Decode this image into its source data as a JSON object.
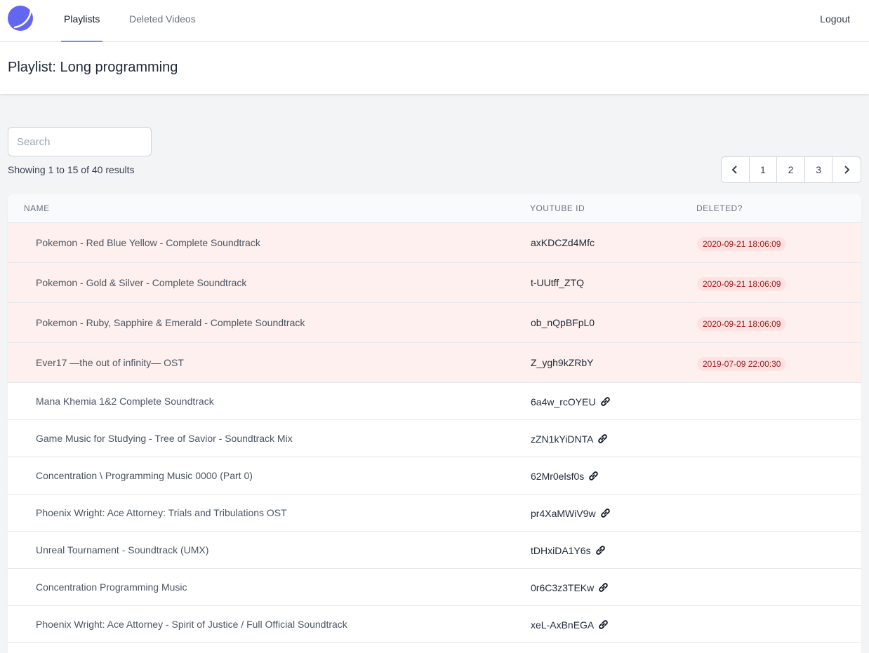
{
  "nav": {
    "tabs": [
      {
        "label": "Playlists",
        "active": true
      },
      {
        "label": "Deleted Videos",
        "active": false
      }
    ],
    "logout_label": "Logout"
  },
  "header": {
    "title": "Playlist: Long programming"
  },
  "search": {
    "placeholder": "Search",
    "value": ""
  },
  "results_text": "Showing 1 to 15 of 40 results",
  "pagination": {
    "pages": [
      "1",
      "2",
      "3"
    ]
  },
  "table": {
    "columns": [
      "NAME",
      "YOUTUBE ID",
      "DELETED?"
    ],
    "rows": [
      {
        "name": "Pokemon - Red Blue Yellow - Complete Soundtrack",
        "youtube_id": "axKDCZd4Mfc",
        "deleted": "2020-09-21 18:06:09"
      },
      {
        "name": "Pokemon - Gold & Silver - Complete Soundtrack",
        "youtube_id": "t-UUtff_ZTQ",
        "deleted": "2020-09-21 18:06:09"
      },
      {
        "name": "Pokemon - Ruby, Sapphire & Emerald - Complete Soundtrack",
        "youtube_id": "ob_nQpBFpL0",
        "deleted": "2020-09-21 18:06:09"
      },
      {
        "name": "Ever17 —the out of infinity— OST",
        "youtube_id": "Z_ygh9kZRbY",
        "deleted": "2019-07-09 22:00:30"
      },
      {
        "name": "Mana Khemia 1&2 Complete Soundtrack",
        "youtube_id": "6a4w_rcOYEU",
        "deleted": ""
      },
      {
        "name": "Game Music for Studying - Tree of Savior - Soundtrack Mix",
        "youtube_id": "zZN1kYiDNTA",
        "deleted": ""
      },
      {
        "name": "Concentration \\ Programming Music 0000 (Part 0)",
        "youtube_id": "62Mr0elsf0s",
        "deleted": ""
      },
      {
        "name": "Phoenix Wright: Ace Attorney: Trials and Tribulations OST",
        "youtube_id": "pr4XaMWiV9w",
        "deleted": ""
      },
      {
        "name": "Unreal Tournament - Soundtrack (UMX)",
        "youtube_id": "tDHxiDA1Y6s",
        "deleted": ""
      },
      {
        "name": "Concentration Programming Music",
        "youtube_id": "0r6C3z3TEKw",
        "deleted": ""
      },
      {
        "name": "Phoenix Wright: Ace Attorney - Spirit of Justice / Full Official Soundtrack",
        "youtube_id": "xeL-AxBnEGA",
        "deleted": ""
      }
    ]
  },
  "colors": {
    "accent": "#6366f1",
    "deleted_row_bg": "#fdf0ee",
    "badge_bg": "#fee2e2",
    "badge_text": "#991b1b"
  }
}
